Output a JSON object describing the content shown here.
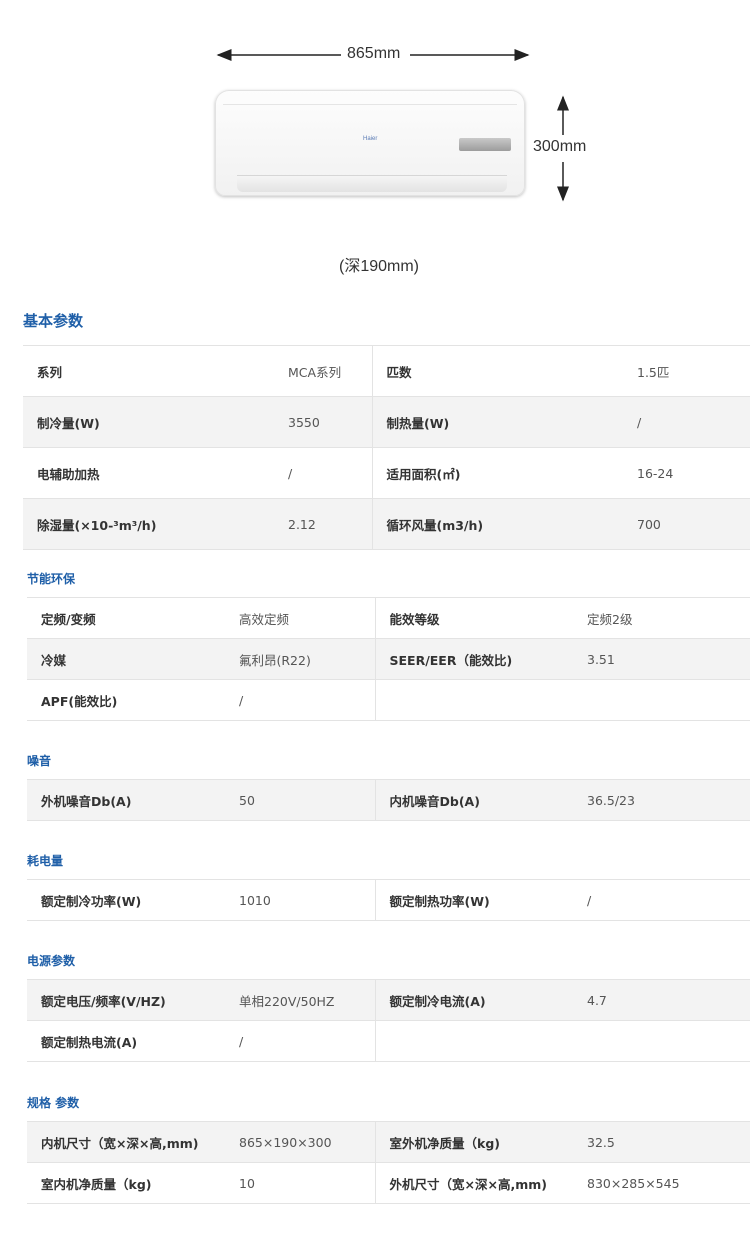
{
  "product": {
    "width_label": "865mm",
    "height_label": "300mm",
    "depth_label": "(深190mm)",
    "brand_logo": "Haier"
  },
  "basic": {
    "title": "基本参数",
    "rows": [
      [
        "系列",
        "MCA系列",
        "匹数",
        "1.5匹"
      ],
      [
        "制冷量(W)",
        "3550",
        "制热量(W)",
        "/"
      ],
      [
        "电辅助加热",
        "/",
        "适用面积(㎡)",
        "16-24"
      ],
      [
        "除湿量(×10-³m³/h)",
        "2.12",
        "循环风量(m3/h)",
        "700"
      ]
    ]
  },
  "sections": [
    {
      "title": "节能环保",
      "rows": [
        [
          "定频/变频",
          "高效定频",
          "能效等级",
          "定频2级"
        ],
        [
          "冷媒",
          "氟利昂(R22)",
          "SEER/EER（能效比)",
          "3.51"
        ],
        [
          "APF(能效比)",
          "/",
          "",
          ""
        ]
      ]
    },
    {
      "title": "噪音",
      "rows": [
        [
          "外机噪音Db(A)",
          "50",
          "内机噪音Db(A)",
          "36.5/23"
        ]
      ]
    },
    {
      "title": "耗电量",
      "rows": [
        [
          "额定制冷功率(W)",
          "1010",
          "额定制热功率(W)",
          "/"
        ]
      ]
    },
    {
      "title": "电源参数",
      "rows": [
        [
          "额定电压/频率(V/HZ)",
          "单相220V/50HZ",
          "额定制冷电流(A)",
          "4.7"
        ],
        [
          "额定制热电流(A)",
          "/",
          "",
          ""
        ]
      ]
    },
    {
      "title": "规格 参数",
      "rows": [
        [
          "内机尺寸（宽×深×高,mm)",
          "865×190×300",
          "室外机净质量（kg)",
          "32.5"
        ],
        [
          "室内机净质量（kg)",
          "10",
          "外机尺寸（宽×深×高,mm)",
          "830×285×545"
        ]
      ]
    }
  ]
}
